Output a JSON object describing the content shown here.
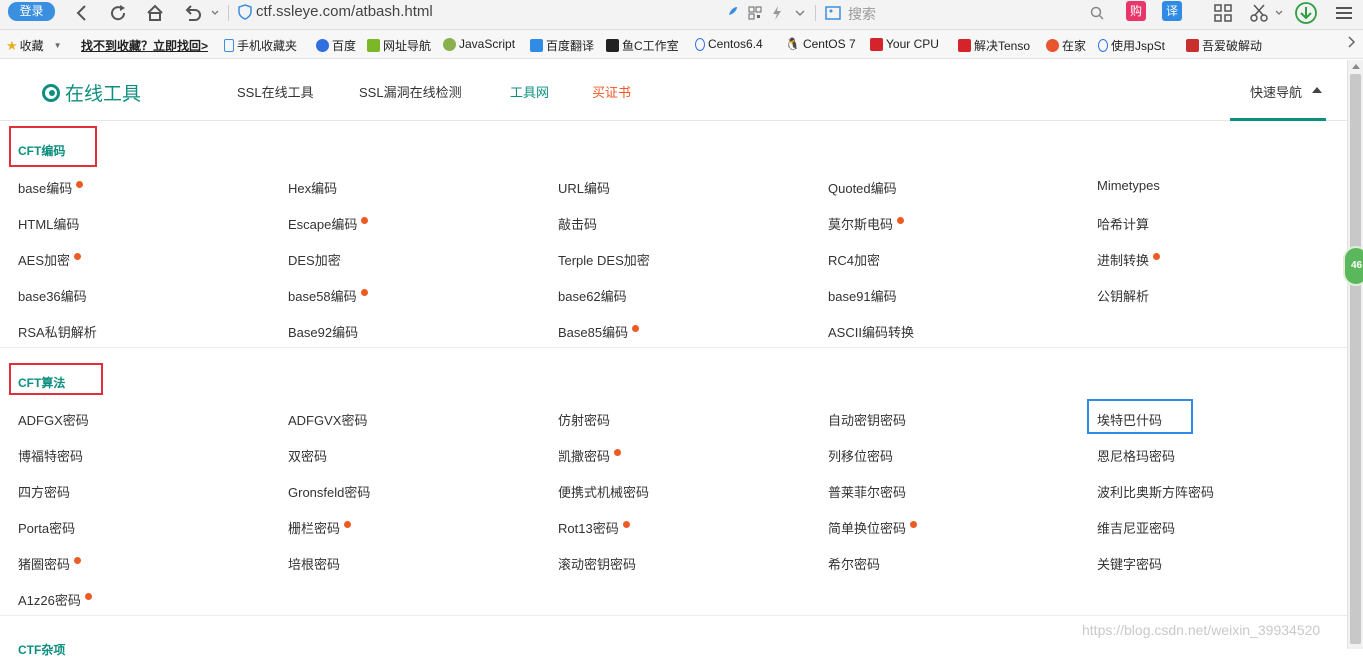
{
  "browser": {
    "login": "登录",
    "url": "ctf.ssleye.com/atbash.html",
    "search_placeholder": "搜索",
    "buy_badge": "购",
    "translate_badge": "译"
  },
  "bookmarks": {
    "favorites": "收藏",
    "warn": "找不到收藏？立即找回>",
    "items": [
      "手机收藏夹",
      "百度",
      "网址导航",
      "JavaScript",
      "百度翻译",
      "鱼C工作室",
      "Centos6.4",
      "CentOS 7",
      "Your CPU",
      "解决Tenso",
      "在家",
      "使用JspSt",
      "吾爱破解动"
    ]
  },
  "site": {
    "logo": "在线工具",
    "nav": [
      "SSL在线工具",
      "SSL漏洞在线检测",
      "工具网",
      "买证书"
    ],
    "quick_nav": "快速导航"
  },
  "sections": [
    {
      "title": "CFT编码",
      "tools": [
        {
          "name": "base编码",
          "hot": true
        },
        {
          "name": "Hex编码",
          "hot": false
        },
        {
          "name": "URL编码",
          "hot": false
        },
        {
          "name": "Quoted编码",
          "hot": false
        },
        {
          "name": "Mimetypes",
          "hot": false
        },
        {
          "name": "HTML编码",
          "hot": false
        },
        {
          "name": "Escape编码",
          "hot": true
        },
        {
          "name": "敲击码",
          "hot": false
        },
        {
          "name": "莫尔斯电码",
          "hot": true
        },
        {
          "name": "哈希计算",
          "hot": false
        },
        {
          "name": "AES加密",
          "hot": true
        },
        {
          "name": "DES加密",
          "hot": false
        },
        {
          "name": "Terple DES加密",
          "hot": false
        },
        {
          "name": "RC4加密",
          "hot": false
        },
        {
          "name": "进制转换",
          "hot": true
        },
        {
          "name": "base36编码",
          "hot": false
        },
        {
          "name": "base58编码",
          "hot": true
        },
        {
          "name": "base62编码",
          "hot": false
        },
        {
          "name": "base91编码",
          "hot": false
        },
        {
          "name": "公钥解析",
          "hot": false
        },
        {
          "name": "RSA私钥解析",
          "hot": false
        },
        {
          "name": "Base92编码",
          "hot": false
        },
        {
          "name": "Base85编码",
          "hot": true
        },
        {
          "name": "ASCII编码转换",
          "hot": false
        }
      ]
    },
    {
      "title": "CFT算法",
      "tools": [
        {
          "name": "ADFGX密码",
          "hot": false
        },
        {
          "name": "ADFGVX密码",
          "hot": false
        },
        {
          "name": "仿射密码",
          "hot": false
        },
        {
          "name": "自动密钥密码",
          "hot": false
        },
        {
          "name": "埃特巴什码",
          "hot": false
        },
        {
          "name": "博福特密码",
          "hot": false
        },
        {
          "name": "双密码",
          "hot": false
        },
        {
          "name": "凯撒密码",
          "hot": true
        },
        {
          "name": "列移位密码",
          "hot": false
        },
        {
          "name": "恩尼格玛密码",
          "hot": false
        },
        {
          "name": "四方密码",
          "hot": false
        },
        {
          "name": "Gronsfeld密码",
          "hot": false
        },
        {
          "name": "便携式机械密码",
          "hot": false
        },
        {
          "name": "普莱菲尔密码",
          "hot": false
        },
        {
          "name": "波利比奥斯方阵密码",
          "hot": false
        },
        {
          "name": "Porta密码",
          "hot": false
        },
        {
          "name": "栅栏密码",
          "hot": true
        },
        {
          "name": "Rot13密码",
          "hot": true
        },
        {
          "name": "简单换位密码",
          "hot": true
        },
        {
          "name": "维吉尼亚密码",
          "hot": false
        },
        {
          "name": "猪圈密码",
          "hot": true
        },
        {
          "name": "培根密码",
          "hot": false
        },
        {
          "name": "滚动密钥密码",
          "hot": false
        },
        {
          "name": "希尔密码",
          "hot": false
        },
        {
          "name": "关键字密码",
          "hot": false
        },
        {
          "name": "A1z26密码",
          "hot": true
        }
      ]
    }
  ],
  "partial_section_title": "CTF杂项",
  "float_badge": "46",
  "watermark": "https://blog.csdn.net/weixin_39934520",
  "colors": {
    "accent": "#0d8f7f",
    "hot_dot": "#ee5a24",
    "highlight_red": "#e0303a",
    "highlight_blue": "#2f8be6"
  }
}
